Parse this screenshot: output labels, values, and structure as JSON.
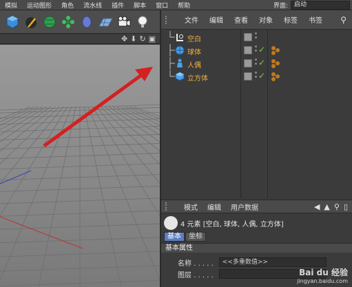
{
  "menubar": {
    "items": [
      "模拟",
      "运动图形",
      "角色",
      "流水线",
      "插件",
      "脚本",
      "窗口",
      "帮助"
    ],
    "layout_label": "界面:",
    "layout_value": "启动"
  },
  "toolbar": {
    "icons": [
      "cube-icon",
      "pen-icon",
      "subdivision-icon",
      "cloner-icon",
      "deformer-icon",
      "floor-icon",
      "camera-icon",
      "light-icon"
    ]
  },
  "object_manager": {
    "menu": [
      "文件",
      "编辑",
      "查看",
      "对象",
      "标签",
      "书签"
    ],
    "objects": [
      {
        "name": "空白",
        "icon": "null-icon",
        "checked": false,
        "tags": false
      },
      {
        "name": "球体",
        "icon": "sphere-icon",
        "checked": true,
        "tags": true
      },
      {
        "name": "人偶",
        "icon": "figure-icon",
        "checked": true,
        "tags": true
      },
      {
        "name": "立方体",
        "icon": "cube-icon",
        "checked": true,
        "tags": true
      }
    ]
  },
  "attribute_manager": {
    "menu": [
      "模式",
      "编辑",
      "用户数据"
    ],
    "info": "4 元素 [空白, 球体, 人偶, 立方体]",
    "tabs": [
      "基本",
      "坐标"
    ],
    "section": "基本属性",
    "fields": [
      {
        "label": "名称 . . . . .",
        "value": "<<多重数值>>"
      },
      {
        "label": "图层 . . . . .",
        "value": ""
      }
    ]
  },
  "watermark": {
    "line1": "Bai du 经验",
    "line2": "jingyan.baidu.com"
  },
  "colors": {
    "object_name": "#f0b040",
    "arrow": "#d42020",
    "accent_tab": "#5b7ec0"
  }
}
